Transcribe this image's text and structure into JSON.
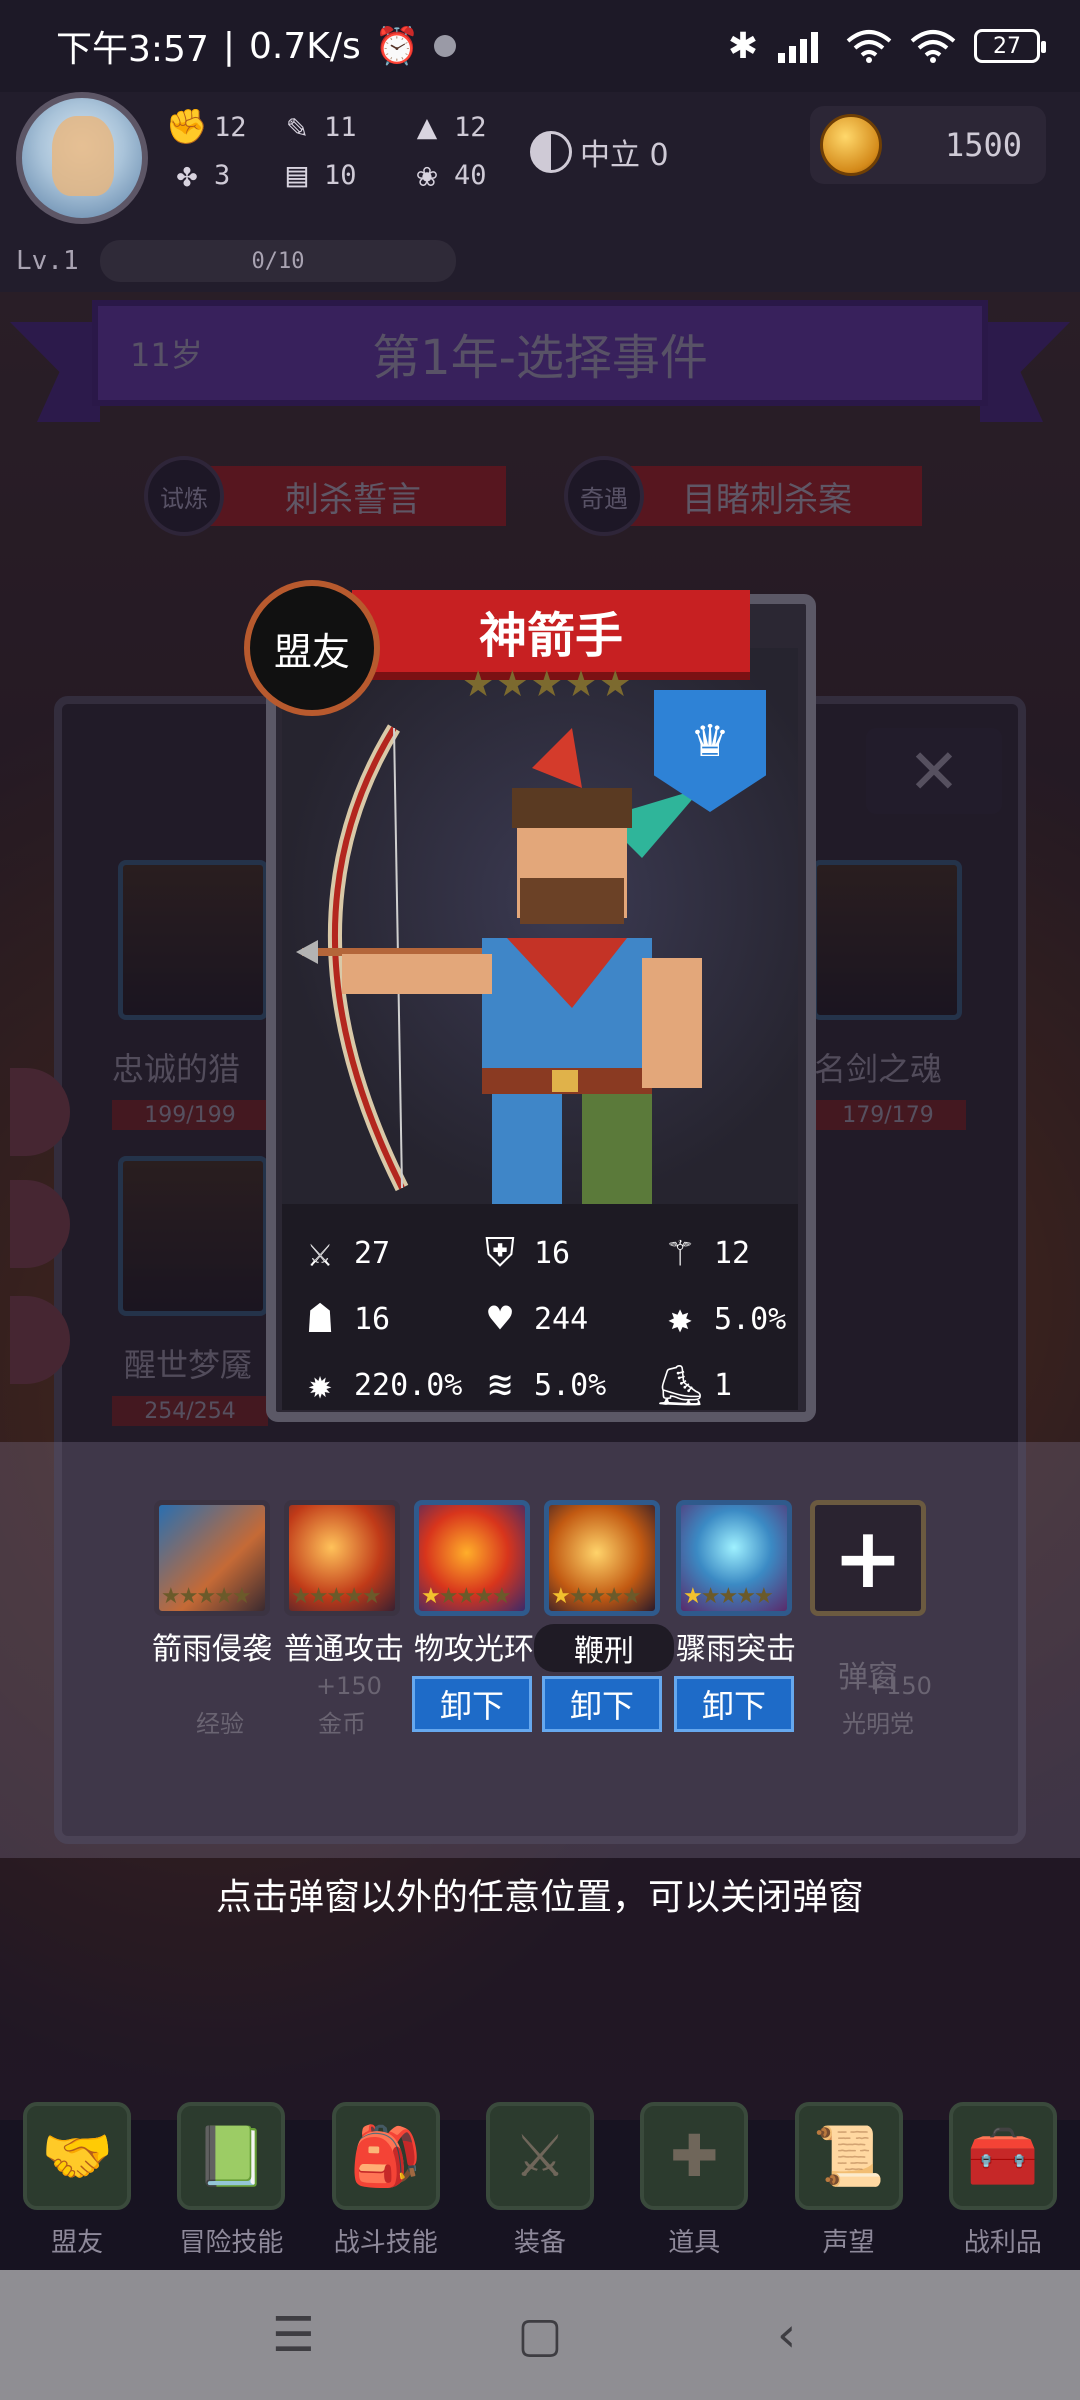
{
  "status_bar": {
    "time": "下午3:57",
    "net_speed": "0.7K/s",
    "battery": "27",
    "icons": [
      "alarm-icon",
      "bluetooth-icon",
      "signal-icon",
      "wifi-icon"
    ]
  },
  "header": {
    "stats": [
      {
        "icon": "fist-icon",
        "value": "12"
      },
      {
        "icon": "book-icon",
        "value": "11"
      },
      {
        "icon": "wizard-hat-icon",
        "value": "12"
      },
      {
        "icon": "clover-icon",
        "value": "3"
      },
      {
        "icon": "scroll-icon",
        "value": "10"
      },
      {
        "icon": "lotus-icon",
        "value": "40"
      }
    ],
    "alignment": "中立 0",
    "coins": "1500",
    "level": "Lv.1",
    "xp": "0/10"
  },
  "banner": {
    "age": "11岁",
    "title": "第1年-选择事件"
  },
  "events": [
    {
      "badge": "试炼",
      "title": "刺杀誓言"
    },
    {
      "badge": "奇遇",
      "title": "目睹刺杀案"
    }
  ],
  "background_allies": [
    {
      "name": "忠诚的猎",
      "hp": "199/199"
    },
    {
      "name": "名剑之魂",
      "hp": "179/179"
    },
    {
      "name": "醒世梦魇",
      "hp": "254/254"
    }
  ],
  "hero": {
    "type_badge": "盟友",
    "name": "神箭手",
    "stars_filled": 0,
    "stars_total": 5,
    "stats": [
      {
        "icon": "sword-icon",
        "value": "27"
      },
      {
        "icon": "shield-icon",
        "value": "16"
      },
      {
        "icon": "staff-icon",
        "value": "12"
      },
      {
        "icon": "hood-icon",
        "value": "16"
      },
      {
        "icon": "heart-icon",
        "value": "244"
      },
      {
        "icon": "crit-burst-icon",
        "value": "5.0%"
      },
      {
        "icon": "crit-damage-icon",
        "value": "220.0%"
      },
      {
        "icon": "tornado-icon",
        "value": "5.0%"
      },
      {
        "icon": "boot-icon",
        "value": "1"
      }
    ]
  },
  "skills": [
    {
      "name": "箭雨侵袭",
      "stars": 0,
      "unload": ""
    },
    {
      "name": "普通攻击",
      "stars": 0,
      "unload": ""
    },
    {
      "name": "物攻光环",
      "stars": 1,
      "unload": "卸下"
    },
    {
      "name": "鞭刑",
      "stars": 1,
      "unload": "卸下"
    },
    {
      "name": "骤雨突击",
      "stars": 1,
      "unload": "卸下"
    }
  ],
  "dimmed_rewards": {
    "exp_label": "经验",
    "gold_value": "+150",
    "gold_label": "金币",
    "faction_label": "光明党",
    "faction_value": "+150",
    "partial_title": "弹窗"
  },
  "hint": "点击弹窗以外的任意位置，可以关闭弹窗",
  "bottom_nav": [
    {
      "label": "盟友",
      "icon": "handshake-icon"
    },
    {
      "label": "冒险技能",
      "icon": "spellbook-icon"
    },
    {
      "label": "战斗技能",
      "icon": "backpack-icon"
    },
    {
      "label": "装备",
      "icon": "crossed-swords-icon"
    },
    {
      "label": "道具",
      "icon": "pouch-icon"
    },
    {
      "label": "声望",
      "icon": "parchment-icon"
    },
    {
      "label": "战利品",
      "icon": "treasure-chest-icon"
    }
  ],
  "system_nav": [
    "☰",
    "▢",
    "‹"
  ]
}
